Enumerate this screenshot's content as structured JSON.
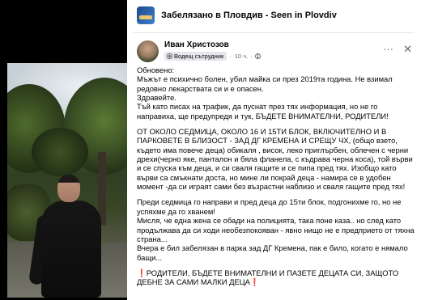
{
  "group": {
    "name": "Забелязано в Пловдив - Seen in Plovdiv"
  },
  "author": {
    "name": "Иван Христозов",
    "badge": "Водещ сътрудник",
    "time": "10 ч."
  },
  "header_actions": {
    "more": "···",
    "close": "✕"
  },
  "post": {
    "p1": [
      "Обновено:",
      "Мъжът е психично болен, убил майка си през 2019та година. Не взимал редовно лекарствата си и е опасен.",
      "Здравейте.",
      "Тъй като писах на трафик, да пуснат през тях информация, но не го направиха, ще предупредя и тук, БЪДЕТЕ ВНИМАТЕЛНИ, РОДИТЕЛИ!"
    ],
    "p2": "ОТ ОКОЛО СЕДМИЦА, ОКОЛО 16 И 15ТИ БЛОК, ВКЛЮЧИТЕЛНО И В ПАРКОВЕТЕ В БЛИЗОСТ - ЗАД ДГ КРЕМЕНА И СРЕЩУ ЧХ, (общо взето, където има повече деца) обикаля , висок, леко приглърбен, облечен с черни дрехи(черно яке, панталон и бяла фланела, с къдрава черна коса), той върви и се спуска към деца, и си сваля гащите и се пипа пред тях. Изобщо като върви са смъкнати доста, но мине ли покрай деца - намира се в удобен момент -да си играят сами без възрастни наблизо и сваля гащите пред тях!",
    "p3": [
      "Преди седмица го направи и пред деца до 15ти блок, подгонихме го, но не успяхме да го хванем!",
      "Мисля, че една жена се обади на полицията, така поне каза.. но след като продължава да си ходи необезпокояван - явно нищо не е предприето от тяхна страна...",
      "Вчера е бил забелязан в парка зад ДГ Кремена, пак е било, когато е нямало бащи..."
    ],
    "warning": "РОДИТЕЛИ, БЪДЕТЕ ВНИМАТЕЛНИ И ПАЗЕТЕ ДЕЦАТА СИ, ЗАЩОТО ДЕБНЕ ЗА САМИ МАЛКИ ДЕЦА",
    "warning_icon": "❗"
  },
  "colors": {
    "warning_red": "#e41e3f",
    "meta_gray": "#65676b",
    "badge_bg": "#e4e6eb"
  }
}
